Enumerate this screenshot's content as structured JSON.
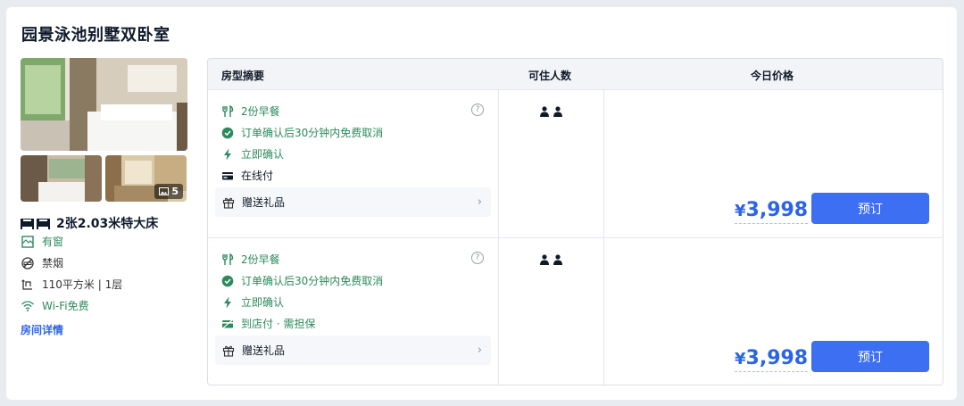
{
  "room": {
    "name": "园景泳池别墅双卧室",
    "photo_count": "5",
    "bed": "2张2.03米特大床",
    "features": [
      {
        "icon": "window-icon",
        "text": "有窗",
        "color": "#2c8a5c"
      },
      {
        "icon": "no-smoking-icon",
        "text": "禁烟",
        "color": "#333333"
      },
      {
        "icon": "area-icon",
        "text": "110平方米 | 1层",
        "color": "#333333"
      },
      {
        "icon": "wifi-icon",
        "text": "Wi-Fi免费",
        "color": "#2c8a5c"
      }
    ],
    "details_link": "房间详情"
  },
  "table": {
    "headers": {
      "summary": "房型摘要",
      "occupancy": "可住人数",
      "price": "今日价格"
    }
  },
  "offers": [
    {
      "breakfast": "2份早餐",
      "cancel": "订单确认后30分钟内免费取消",
      "confirm": "立即确认",
      "payment": "在线付",
      "gift": "赠送礼品",
      "currency": "¥",
      "price": "3,998",
      "book_label": "预订"
    },
    {
      "breakfast": "2份早餐",
      "cancel": "订单确认后30分钟内免费取消",
      "confirm": "立即确认",
      "payment": "到店付 · 需担保",
      "gift": "赠送礼品",
      "currency": "¥",
      "price": "3,998",
      "book_label": "预订"
    }
  ],
  "colors": {
    "accent": "#3d6ff2",
    "price": "#2b64e8",
    "green": "#2c8a5c"
  }
}
